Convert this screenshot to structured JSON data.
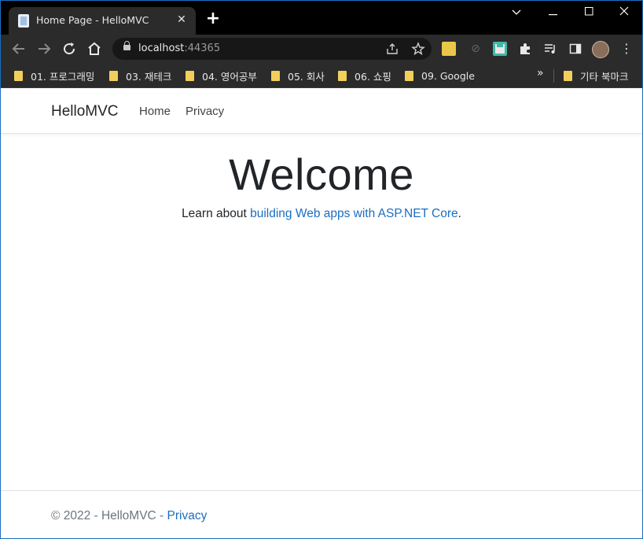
{
  "browser": {
    "tab_title": "Home Page - HelloMVC",
    "url_host": "localhost",
    "url_port": ":44365",
    "icons": [
      "back-icon",
      "forward-icon",
      "reload-icon",
      "home-icon",
      "share-icon",
      "star-icon",
      "puzzle-icon",
      "media-icon",
      "sidebar-icon",
      "profile-avatar",
      "menu-icon"
    ]
  },
  "bookmarks": [
    {
      "label": "01. 프로그래밍"
    },
    {
      "label": "03. 재테크"
    },
    {
      "label": "04. 영어공부"
    },
    {
      "label": "05. 회사"
    },
    {
      "label": "06. 쇼핑"
    },
    {
      "label": "09. Google"
    }
  ],
  "bookmarks_more": "»",
  "other_bookmarks": "기타 북마크",
  "site": {
    "brand": "HelloMVC",
    "nav": [
      {
        "label": "Home"
      },
      {
        "label": "Privacy"
      }
    ]
  },
  "main": {
    "heading": "Welcome",
    "learn_prefix": "Learn about ",
    "learn_link": "building Web apps with ASP.NET Core",
    "learn_suffix": "."
  },
  "footer": {
    "text": "© 2022 - HelloMVC - ",
    "link": "Privacy"
  },
  "colors": {
    "link": "#1b6ec2",
    "window_border": "#1a6fc4",
    "chrome_dark": "#2b2b2b"
  }
}
